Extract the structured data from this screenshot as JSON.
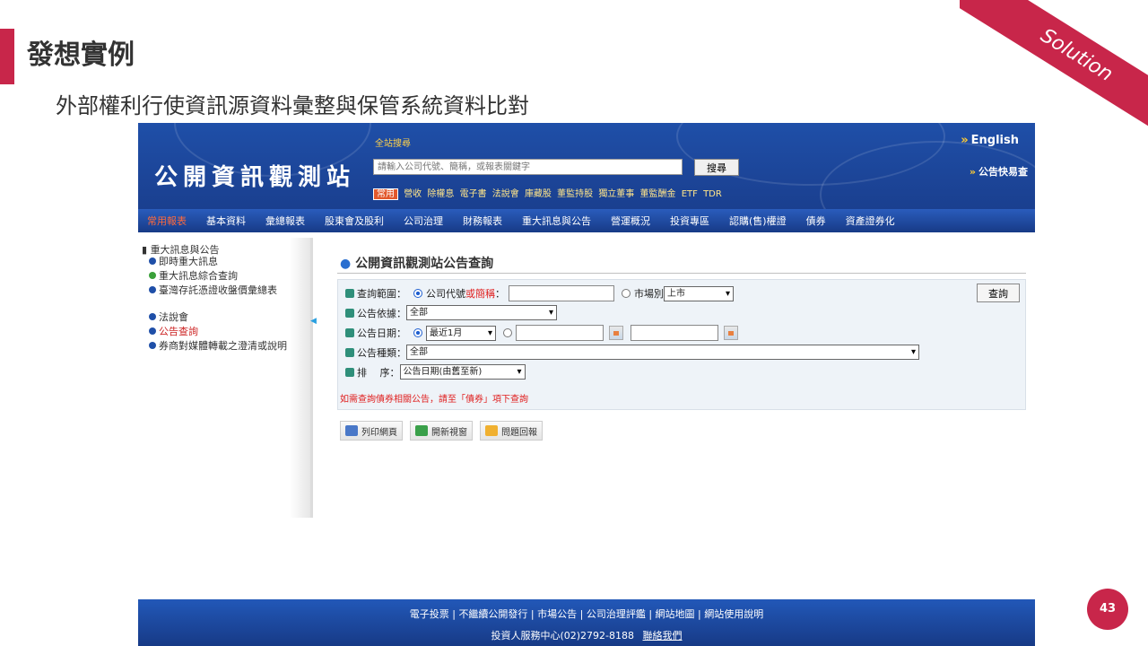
{
  "slide": {
    "title": "發想實例",
    "subtitle": "外部權利行使資訊源資料彙整與保管系統資料比對",
    "ribbon": "Solution",
    "page_number": "43",
    "accent_color": "#c8264a"
  },
  "site": {
    "logo": "公開資訊觀測站",
    "search_label": "全站搜尋",
    "search_placeholder": "請輸入公司代號、簡稱，或報表關鍵字",
    "search_button": "搜尋",
    "quick_badge": "常用",
    "quick_tags": [
      "營收",
      "除權息",
      "電子書",
      "法說會",
      "庫藏股",
      "董監持股",
      "獨立董事",
      "董監酬金",
      "ETF",
      "TDR"
    ],
    "english_link": "English",
    "quick_query_link": "公告快易查",
    "header_color": "#1f4fa8",
    "nav": [
      "常用報表",
      "基本資料",
      "彙總報表",
      "股東會及股利",
      "公司治理",
      "財務報表",
      "重大訊息與公告",
      "營運概況",
      "投資專區",
      "認購(售)權證",
      "債券",
      "資產證券化"
    ]
  },
  "sidebar": {
    "title": "重大訊息與公告",
    "items": [
      "即時重大訊息",
      "重大訊息綜合查詢",
      "臺灣存託憑證收盤價彙總表",
      "法說會",
      "公告查詢",
      "券商對媒體轉載之澄清或說明"
    ]
  },
  "form": {
    "panel_title": "公開資訊觀測站公告查詢",
    "scope_label": "查詢範圍：",
    "scope_company_label": "公司代號",
    "scope_company_or": "或簡稱",
    "scope_company_suffix": "：",
    "scope_market_label": "市場別",
    "scope_market_value": "上市",
    "submit": "查詢",
    "basis_label": "公告依據：",
    "basis_value": "全部",
    "date_label": "公告日期：",
    "date_value": "最近1月",
    "type_label": "公告種類：",
    "type_value": "全部",
    "sort_label": "排　 序：",
    "sort_value": "公告日期(由舊至新)",
    "notice": "如需查詢債券相關公告，請至「債券」項下查詢"
  },
  "actions": [
    "列印網頁",
    "開新視窗",
    "問題回報"
  ],
  "footer": {
    "links": [
      "電子投票",
      "不繼續公開發行",
      "市場公告",
      "公司治理評鑑",
      "網站地圖",
      "網站使用說明"
    ],
    "service": "投資人服務中心(02)2792-8188",
    "contact": "聯絡我們"
  }
}
